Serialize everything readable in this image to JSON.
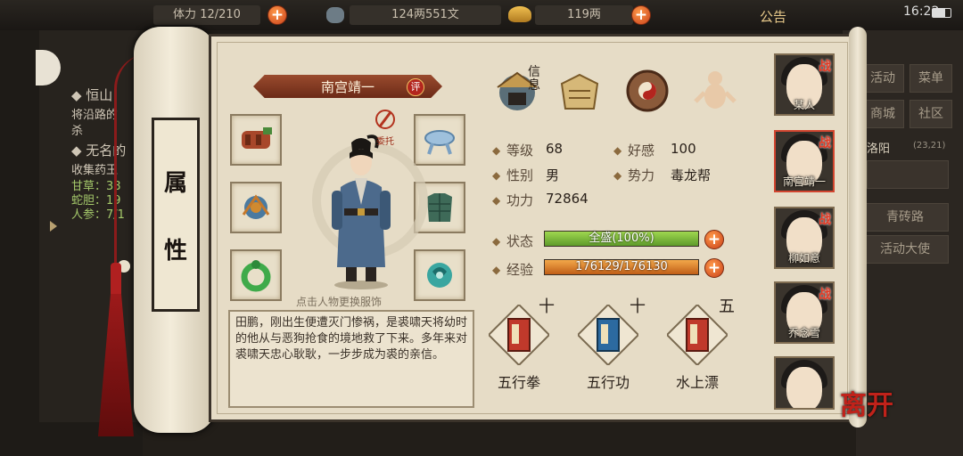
{
  "topbar": {
    "stamina_label": "体力",
    "stamina": "12/210",
    "silver": "124两551文",
    "gold": "119两",
    "notice": "公告",
    "clock": "16:22"
  },
  "background_left": {
    "quest1_title": "◆ 恒山",
    "quest1_line1": "将沿路的",
    "quest1_line2": "杀",
    "quest2_title": "◆ 无名的",
    "quest2_line1": "收集药王",
    "items": [
      "甘草：38",
      "蛇胆：19",
      "人参：7/1"
    ]
  },
  "background_right": {
    "buttons": [
      "活动",
      "菜单",
      "商城",
      "社区"
    ],
    "location": "洛阳",
    "coords": "(23,21)",
    "road": "青砖路",
    "ambassador": "活动大使"
  },
  "scroll": {
    "tab_char1": "属",
    "tab_char2": "性"
  },
  "character": {
    "name": "南宫靖一",
    "rate_badge": "评",
    "entrust_label": "委托",
    "hint": "点击人物更换服饰",
    "bio": "田鹏，刚出生便遭灭门惨祸，是裘啸天将幼时的他从与恶狗抢食的境地救了下来。多年来对裘啸天忠心耿耿，一步步成为裘的亲信。"
  },
  "top_icons": [
    {
      "name": "info-icon",
      "label": "信息"
    },
    {
      "name": "scroll-map-icon",
      "label": ""
    },
    {
      "name": "bagua-icon",
      "label": ""
    },
    {
      "name": "meridian-figure-icon",
      "label": ""
    }
  ],
  "stats": {
    "level_label": "等级",
    "level": "68",
    "favor_label": "好感",
    "favor": "100",
    "gender_label": "性别",
    "gender": "男",
    "faction_label": "势力",
    "faction": "毒龙帮",
    "power_label": "功力",
    "power": "72864",
    "state_label": "状态",
    "state_text": "全盛(100%)",
    "state_fill": 1.0,
    "exp_label": "经验",
    "exp_text": "176129/176130",
    "exp_fill": 0.99999
  },
  "skills": [
    {
      "name": "五行拳",
      "level": "十",
      "color": "#c0392b"
    },
    {
      "name": "五行功",
      "level": "十",
      "color": "#2c6aa0"
    },
    {
      "name": "水上漂",
      "level": "五",
      "color": "#c0392b"
    }
  ],
  "roster": [
    {
      "name": "某人",
      "battle": "战",
      "selected": false
    },
    {
      "name": "南宫靖一",
      "battle": "战",
      "selected": true
    },
    {
      "name": "柳如意",
      "battle": "战",
      "selected": false
    },
    {
      "name": "乔念雪",
      "battle": "战",
      "selected": false
    },
    {
      "name": "",
      "battle": "",
      "selected": false
    }
  ],
  "leave_label": "离开",
  "colors": {
    "accent": "#d2452f",
    "state_bar": "#7fbf3f",
    "exp_bar": "#e0842a",
    "panel": "#e6dcc6"
  }
}
